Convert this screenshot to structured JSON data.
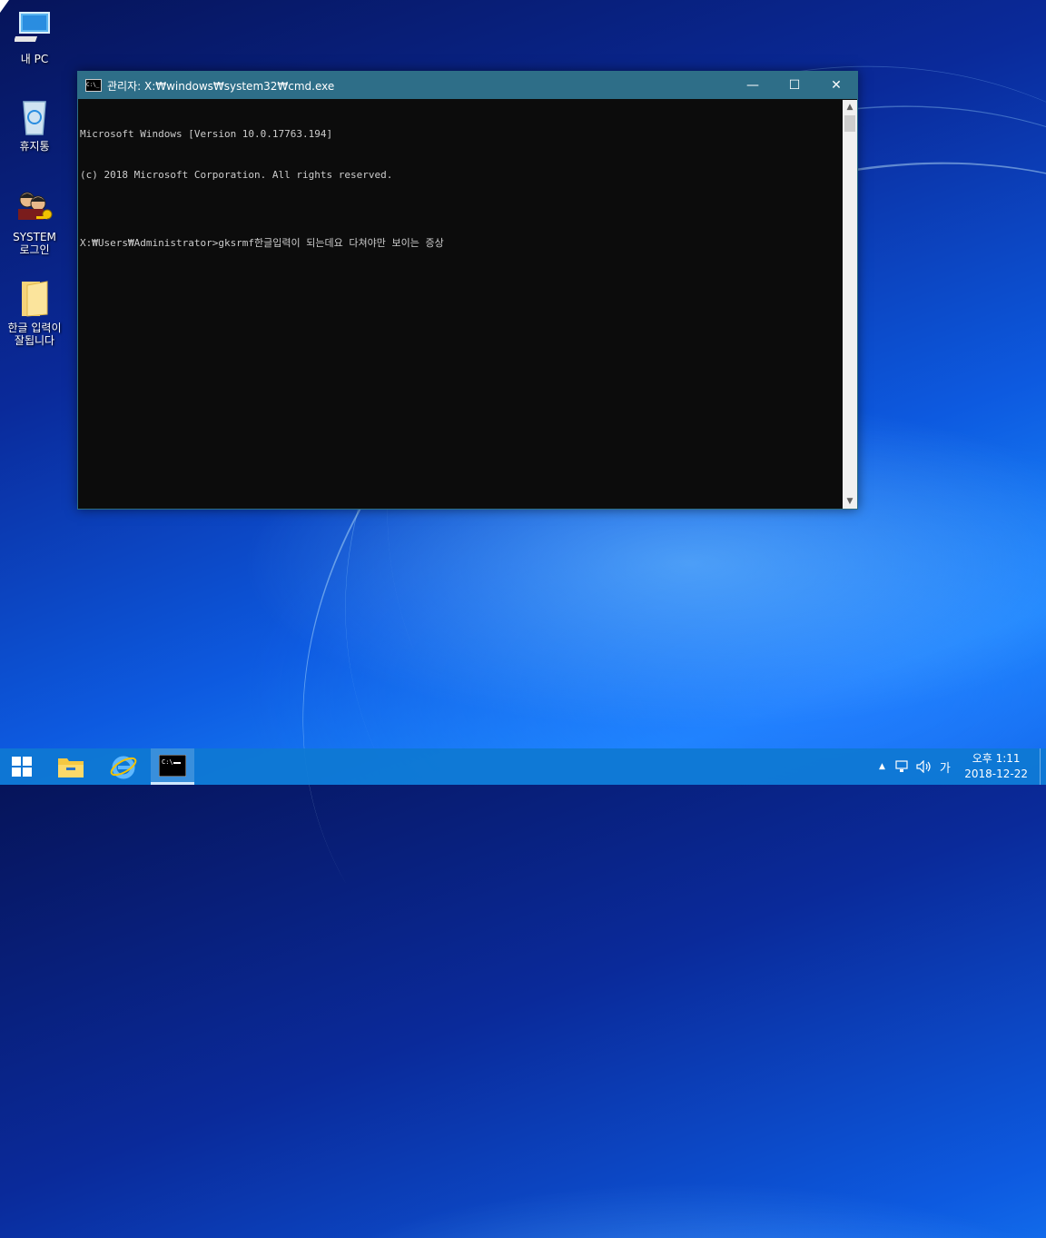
{
  "desktop": {
    "icons": [
      {
        "label": "내 PC",
        "icon": "computer-icon"
      },
      {
        "label": "휴지통",
        "icon": "recycle-bin-icon"
      },
      {
        "label": "SYSTEM\n로그인",
        "icon": "users-key-icon"
      },
      {
        "label": "한글 입력이\n잘됩니다",
        "icon": "folder-icon"
      }
    ]
  },
  "window": {
    "title": "관리자: X:₩windows₩system32₩cmd.exe",
    "minimize": "—",
    "maximize": "☐",
    "close": "✕",
    "console_lines": [
      "Microsoft Windows [Version 10.0.17763.194]",
      "(c) 2018 Microsoft Corporation. All rights reserved.",
      "",
      "X:₩Users₩Administrator>gksrmf한글입력이 되는데요 다쳐야만 보이는 증상"
    ]
  },
  "taskbar": {
    "items": [
      "start-icon",
      "file-explorer-icon",
      "internet-explorer-icon",
      "cmd-icon"
    ],
    "tray": {
      "chevron": "▲",
      "ime": "가"
    },
    "clock": {
      "time": "오후 1:11",
      "date": "2018-12-22"
    }
  },
  "colors": {
    "titlebar": "#2e6e88",
    "console_bg": "#0c0c0c",
    "console_fg": "#cccccc",
    "taskbar": "#0e78d2"
  }
}
